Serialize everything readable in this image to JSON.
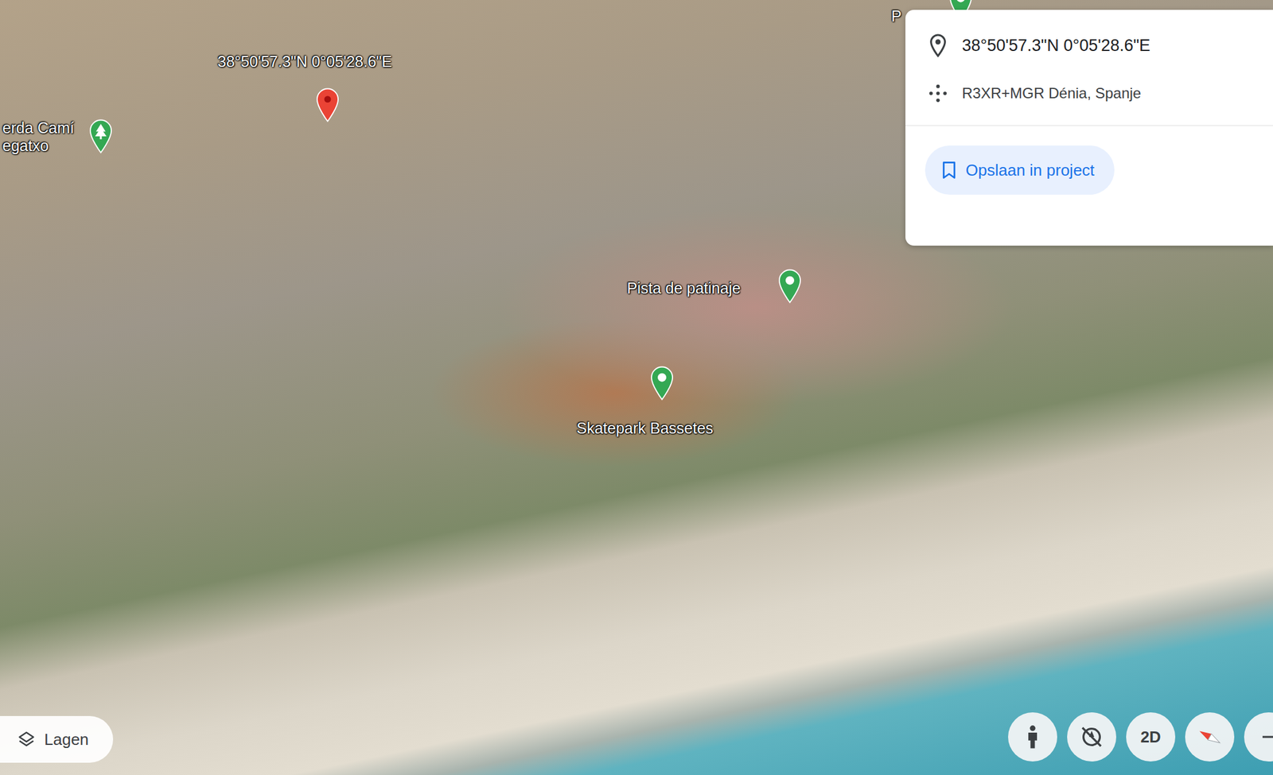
{
  "places": [
    {
      "label": "38°50'57.3\"N 0°05'28.6\"E",
      "kind": "dropped",
      "color": "#ea4335"
    },
    {
      "label": "erda Camí\negatxo",
      "kind": "park",
      "color": "#34a853"
    },
    {
      "label": "Pista de patinaje",
      "kind": "place",
      "color": "#34a853"
    },
    {
      "label": "Skatepark Bassetes",
      "kind": "place",
      "color": "#34a853"
    },
    {
      "label": "P",
      "kind": "place",
      "color": "#34a853"
    }
  ],
  "info_panel": {
    "coordinates": "38°50'57.3\"N 0°05'28.6\"E",
    "plus_code": "R3XR+MGR Dénia, Spanje",
    "save_button": "Opslaan in project"
  },
  "layers_button": {
    "label": "Lagen"
  },
  "controls": [
    {
      "kind": "pegman"
    },
    {
      "kind": "tilt"
    },
    {
      "kind": "view",
      "label": "2D"
    },
    {
      "kind": "compass"
    },
    {
      "kind": "zoom"
    }
  ]
}
